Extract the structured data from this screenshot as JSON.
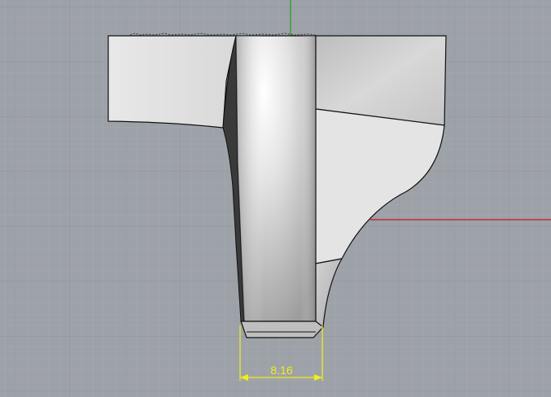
{
  "viewport": {
    "background": "#9da2a8",
    "grid_minor_color": "#a9adb3",
    "grid_major_color": "#8f949a",
    "axis_x_color": "#c8141e",
    "axis_y_color": "#1aa31a"
  },
  "model": {
    "outline_color": "#111111",
    "shade_light": "#f2f2f2",
    "shade_mid": "#cfcfcf",
    "shade_dark": "#3a3a3a"
  },
  "dimension": {
    "value": "8.16",
    "color": "#f2ee1a"
  }
}
